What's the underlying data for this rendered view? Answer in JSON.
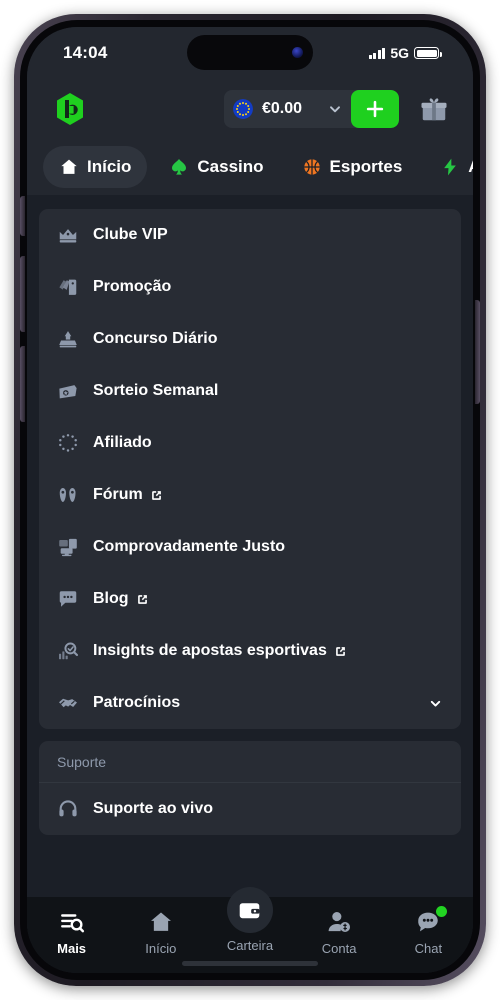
{
  "colors": {
    "brand_green": "#1fd01f",
    "screen_bg": "#1b1f27",
    "card_bg": "#282c34",
    "header_bg": "#23272f",
    "nav_bg": "#101317",
    "icon_grey": "#8e99ab",
    "badge_green": "#22d422"
  },
  "status_bar": {
    "time": "14:04",
    "network": "5G",
    "signal_icon": "signal-bars-icon",
    "battery_icon": "battery-icon"
  },
  "header": {
    "logo_icon": "brand-logo-icon",
    "balance": {
      "flag_icon": "eu-flag-icon",
      "amount": "€0.00",
      "caret_icon": "chevron-down-icon"
    },
    "deposit_icon": "plus-icon",
    "gift_icon": "gift-icon"
  },
  "category_tabs": [
    {
      "label": "Início",
      "icon": "home-icon",
      "active": true
    },
    {
      "label": "Cassino",
      "icon": "spade-icon",
      "active": false
    },
    {
      "label": "Esportes",
      "icon": "basketball-icon",
      "active": false
    },
    {
      "label": "Acima Ab",
      "icon": "lightning-icon",
      "active": false
    }
  ],
  "menu": {
    "items": [
      {
        "label": "Clube VIP",
        "icon": "crown-icon",
        "external": false,
        "expandable": false
      },
      {
        "label": "Promoção",
        "icon": "tags-icon",
        "external": false,
        "expandable": false
      },
      {
        "label": "Concurso Diário",
        "icon": "podium-icon",
        "external": false,
        "expandable": false
      },
      {
        "label": "Sorteio Semanal",
        "icon": "ticket-icon",
        "external": false,
        "expandable": false
      },
      {
        "label": "Afiliado",
        "icon": "dotted-ring-icon",
        "external": false,
        "expandable": false
      },
      {
        "label": "Fórum",
        "icon": "forum-icon",
        "external": true,
        "expandable": false
      },
      {
        "label": "Comprovadamente Justo",
        "icon": "monitor-icon",
        "external": false,
        "expandable": false
      },
      {
        "label": "Blog",
        "icon": "chat-bubble-icon",
        "external": true,
        "expandable": false
      },
      {
        "label": "Insights de apostas esportivas",
        "icon": "analytics-icon",
        "external": true,
        "expandable": false
      },
      {
        "label": "Patrocínios",
        "icon": "handshake-icon",
        "external": false,
        "expandable": true
      }
    ]
  },
  "support": {
    "heading": "Suporte",
    "items": [
      {
        "label": "Suporte ao vivo",
        "icon": "headset-icon"
      }
    ]
  },
  "bottom_nav": [
    {
      "label": "Mais",
      "icon": "list-search-icon",
      "active": true,
      "raised": false,
      "badge": false
    },
    {
      "label": "Início",
      "icon": "home-icon",
      "active": false,
      "raised": false,
      "badge": false
    },
    {
      "label": "Carteira",
      "icon": "wallet-icon",
      "active": false,
      "raised": true,
      "badge": false
    },
    {
      "label": "Conta",
      "icon": "account-icon",
      "active": false,
      "raised": false,
      "badge": false
    },
    {
      "label": "Chat",
      "icon": "chat-dots-icon",
      "active": false,
      "raised": false,
      "badge": true
    }
  ]
}
